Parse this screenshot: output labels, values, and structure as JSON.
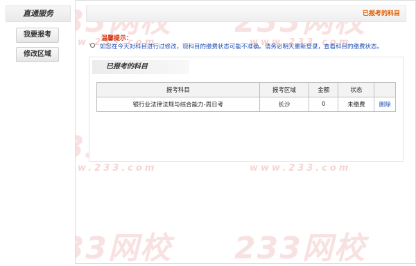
{
  "sidebar": {
    "title": "直通服务",
    "buttons": [
      {
        "label": "我要报考"
      },
      {
        "label": "修改区域"
      }
    ]
  },
  "header": {
    "title": "已报考的科目"
  },
  "notice": {
    "title": "温馨提示：",
    "text": "如您在今天对科目进行过修改，现科目的缴费状态可能不准确。请务必明天重新登录，查看科目的缴费状态。"
  },
  "panel": {
    "title": "已报考的科目"
  },
  "table": {
    "headers": [
      "报考科目",
      "报考区域",
      "金额",
      "状态",
      ""
    ],
    "rows": [
      {
        "subject": "银行业法律法规与综合能力-周日考",
        "region": "长沙",
        "amount": "0",
        "status": "未缴费",
        "action": "删除"
      }
    ]
  },
  "watermark": {
    "text": "233网校",
    "url": "www.233.com"
  },
  "colors": {
    "accent": "#e05a00",
    "link": "#1f4fb4",
    "notice_title": "#d03010"
  }
}
